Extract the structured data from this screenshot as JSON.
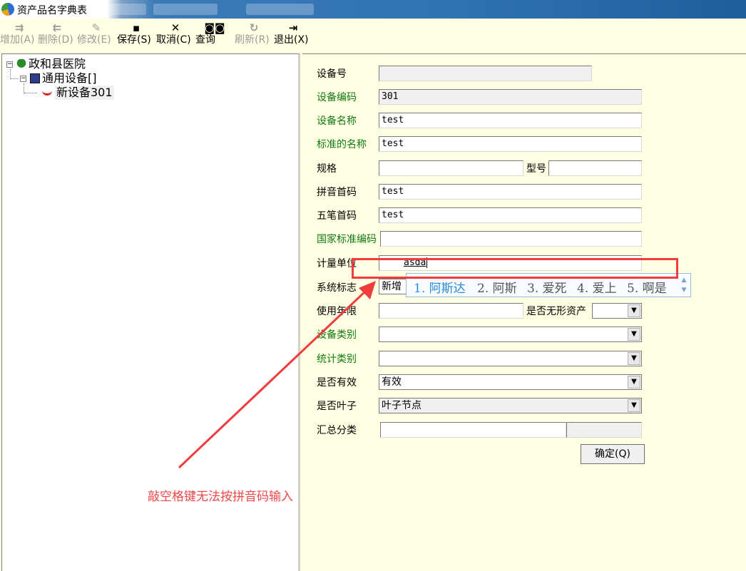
{
  "window": {
    "title": "资产品名字典表"
  },
  "toolbar": {
    "add": {
      "label": "增加(A)"
    },
    "delete": {
      "label": "删除(D)"
    },
    "edit": {
      "label": "修改(E)"
    },
    "save": {
      "label": "保存(S)"
    },
    "cancel": {
      "label": "取消(C)"
    },
    "query": {
      "label": "查询"
    },
    "refresh": {
      "label": "刷新(R)"
    },
    "exit": {
      "label": "退出(X)"
    }
  },
  "tree": {
    "root": "政和县医院",
    "child": "通用设备[]",
    "leaf": "新设备301"
  },
  "form": {
    "device_no": {
      "label": "设备号",
      "value": ""
    },
    "device_code": {
      "label": "设备编码",
      "value": "301"
    },
    "device_name": {
      "label": "设备名称",
      "value": "test"
    },
    "std_name": {
      "label": "标准的名称",
      "value": "test"
    },
    "spec": {
      "label": "规格",
      "value": ""
    },
    "model": {
      "label": "型号",
      "value": ""
    },
    "pinyin": {
      "label": "拼音首码",
      "value": "test"
    },
    "wubi": {
      "label": "五笔首码",
      "value": "test"
    },
    "national_code": {
      "label": "国家标准编码",
      "value": ""
    },
    "unit": {
      "label": "计量单位",
      "value": "asda"
    },
    "sys_flag": {
      "label": "系统标志",
      "value": "新增"
    },
    "years": {
      "label": "使用年限",
      "value": ""
    },
    "intangible": {
      "label": "是否无形资产",
      "value": ""
    },
    "device_category": {
      "label": "设备类别",
      "value": ""
    },
    "stat_category": {
      "label": "统计类别",
      "value": ""
    },
    "valid": {
      "label": "是否有效",
      "value": "有效"
    },
    "leaf": {
      "label": "是否叶子",
      "value": "叶子节点"
    },
    "summary": {
      "label": "汇总分类",
      "value": ""
    },
    "confirm_button": "确定(Q)"
  },
  "ime": {
    "candidates": [
      "1. 阿斯达",
      "2. 阿斯",
      "3. 爱死",
      "4. 爱上",
      "5. 啊是"
    ]
  },
  "annotation": {
    "text": "敲空格键无法按拼音码输入",
    "color": "#f03c3c"
  }
}
